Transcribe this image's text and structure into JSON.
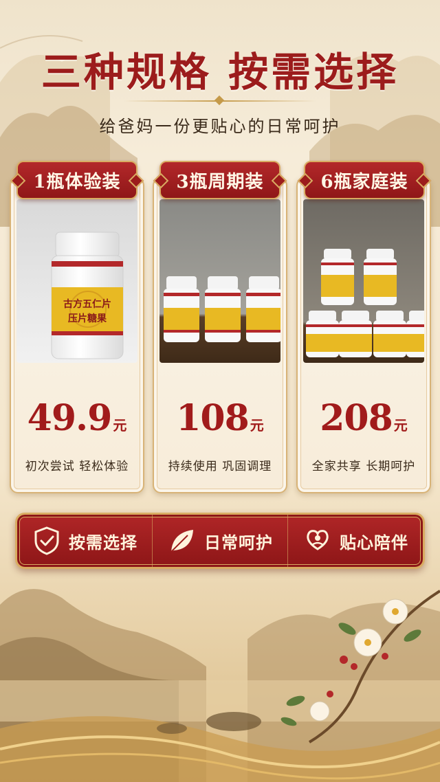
{
  "header": {
    "title": "三种规格 按需选择",
    "subtitle": "给爸妈一份更贴心的日常呵护"
  },
  "product_label": {
    "line1": "古方五仁片",
    "line2": "压片糖果"
  },
  "packages": [
    {
      "label": "1瓶体验装",
      "price": "49.9",
      "unit": "元",
      "desc": "初次尝试 轻松体验"
    },
    {
      "label": "3瓶周期装",
      "price": "108",
      "unit": "元",
      "desc": "持续使用 巩固调理"
    },
    {
      "label": "6瓶家庭装",
      "price": "208",
      "unit": "元",
      "desc": "全家共享 长期呵护"
    }
  ],
  "features": [
    {
      "icon": "shield-check-icon",
      "label": "按需选择"
    },
    {
      "icon": "leaf-icon",
      "label": "日常呵护"
    },
    {
      "icon": "heart-hands-icon",
      "label": "贴心陪伴"
    }
  ],
  "colors": {
    "accent_red": "#9c1c1c",
    "gold": "#d9ac62",
    "background": "#f6ecd9"
  }
}
